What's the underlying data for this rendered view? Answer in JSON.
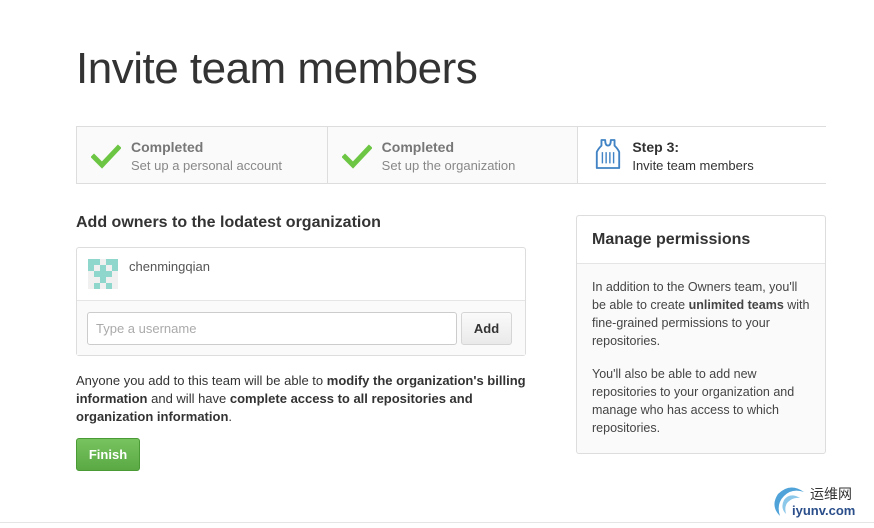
{
  "page": {
    "title": "Invite team members"
  },
  "steps": [
    {
      "title": "Completed",
      "description": "Set up a personal account",
      "icon": "check-icon",
      "status": "completed"
    },
    {
      "title": "Completed",
      "description": "Set up the organization",
      "icon": "check-icon",
      "status": "completed"
    },
    {
      "title": "Step 3:",
      "description": "Invite team members",
      "icon": "jersey-icon",
      "status": "current"
    }
  ],
  "owners": {
    "heading": "Add owners to the lodatest organization",
    "members": [
      {
        "username": "chenmingqian"
      }
    ],
    "input_placeholder": "Type a username",
    "add_label": "Add"
  },
  "notice": {
    "part1": "Anyone you add to this team will be able to ",
    "bold1": "modify the organization's billing information",
    "part2": " and will have ",
    "bold2": "complete access to all repositories and organization information",
    "part3": "."
  },
  "finish_label": "Finish",
  "permissions": {
    "title": "Manage permissions",
    "p1_part1": "In addition to the Owners team, you'll be able to create ",
    "p1_bold": "unlimited teams",
    "p1_part2": " with fine-grained permissions to your repositories.",
    "p2": "You'll also be able to add new repositories to your organization and manage who has access to which repositories."
  },
  "watermark": {
    "cn": "运维网",
    "url": "iyunv.com"
  },
  "colors": {
    "check": "#6cc644",
    "finish": "#60b044",
    "jersey": "#4183c4"
  }
}
